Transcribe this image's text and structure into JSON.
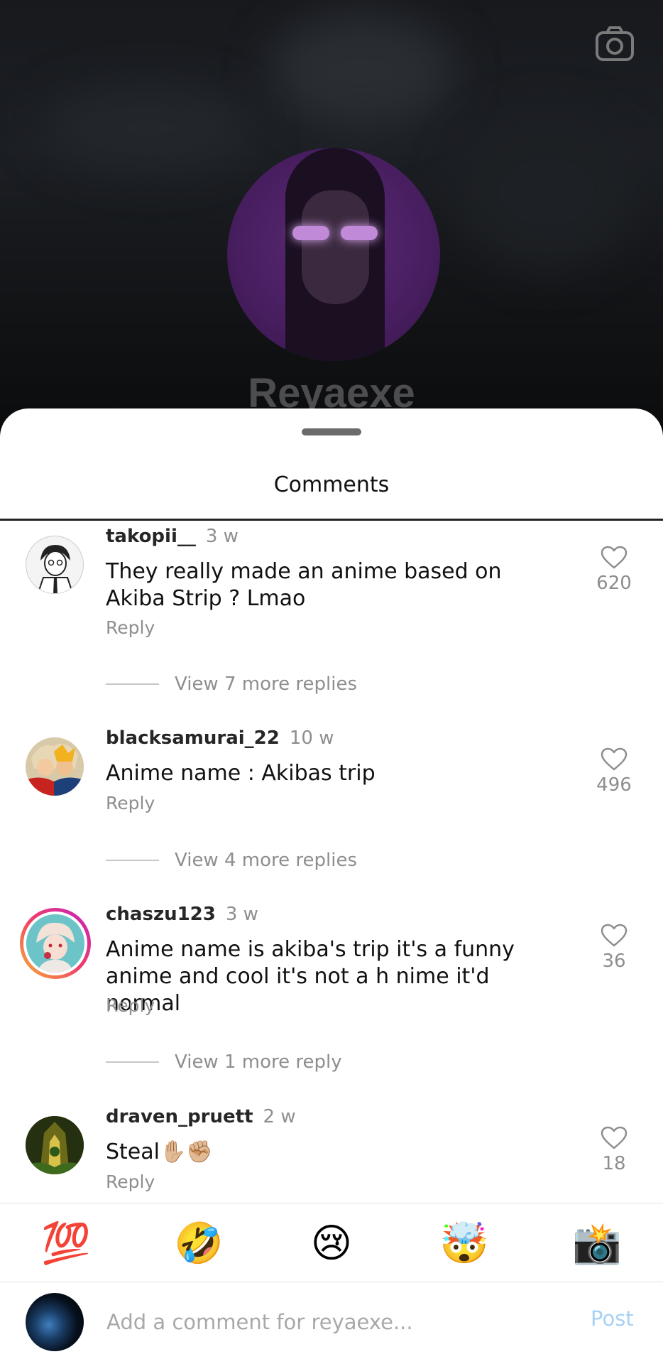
{
  "profile": {
    "name": "Reyaexe"
  },
  "sheet": {
    "title": "Comments"
  },
  "comments": [
    {
      "username": "takopii__",
      "time": "3 w",
      "text": "They really made an anime based on Akiba Strip ? Lmao",
      "likes": "620",
      "reply_label": "Reply",
      "view_replies": "View 7 more replies"
    },
    {
      "username": "blacksamurai_22",
      "time": "10 w",
      "text": "Anime name : Akibas trip",
      "likes": "496",
      "reply_label": "Reply",
      "view_replies": "View 4 more replies"
    },
    {
      "username": "chaszu123",
      "time": "3 w",
      "text": "Anime name is akiba's trip it's a funny anime and cool it's not a h nime it'd normal",
      "likes": "36",
      "reply_label": "Reply",
      "view_replies": "View 1 more reply"
    },
    {
      "username": "draven_pruett",
      "time": "2 w",
      "text": "Steal✋🏼✊🏼",
      "likes": "18",
      "reply_label": "Reply"
    }
  ],
  "emoji_bar": [
    "💯",
    "🤣",
    "😢",
    "🤯",
    "📸"
  ],
  "input": {
    "placeholder": "Add a comment for reyaexe...",
    "post_label": "Post"
  },
  "icons": {
    "camera": "camera-icon",
    "like": "heart-outline-icon"
  }
}
